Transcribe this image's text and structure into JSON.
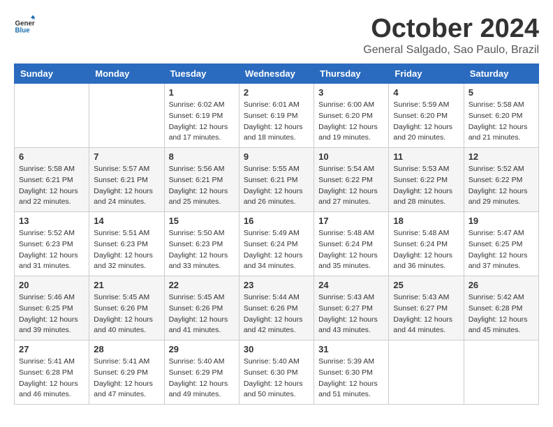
{
  "header": {
    "logo_general": "General",
    "logo_blue": "Blue",
    "month_title": "October 2024",
    "location": "General Salgado, Sao Paulo, Brazil"
  },
  "calendar": {
    "days_of_week": [
      "Sunday",
      "Monday",
      "Tuesday",
      "Wednesday",
      "Thursday",
      "Friday",
      "Saturday"
    ],
    "weeks": [
      [
        {
          "day": "",
          "info": ""
        },
        {
          "day": "",
          "info": ""
        },
        {
          "day": "1",
          "info": "Sunrise: 6:02 AM\nSunset: 6:19 PM\nDaylight: 12 hours\nand 17 minutes."
        },
        {
          "day": "2",
          "info": "Sunrise: 6:01 AM\nSunset: 6:19 PM\nDaylight: 12 hours\nand 18 minutes."
        },
        {
          "day": "3",
          "info": "Sunrise: 6:00 AM\nSunset: 6:20 PM\nDaylight: 12 hours\nand 19 minutes."
        },
        {
          "day": "4",
          "info": "Sunrise: 5:59 AM\nSunset: 6:20 PM\nDaylight: 12 hours\nand 20 minutes."
        },
        {
          "day": "5",
          "info": "Sunrise: 5:58 AM\nSunset: 6:20 PM\nDaylight: 12 hours\nand 21 minutes."
        }
      ],
      [
        {
          "day": "6",
          "info": "Sunrise: 5:58 AM\nSunset: 6:21 PM\nDaylight: 12 hours\nand 22 minutes."
        },
        {
          "day": "7",
          "info": "Sunrise: 5:57 AM\nSunset: 6:21 PM\nDaylight: 12 hours\nand 24 minutes."
        },
        {
          "day": "8",
          "info": "Sunrise: 5:56 AM\nSunset: 6:21 PM\nDaylight: 12 hours\nand 25 minutes."
        },
        {
          "day": "9",
          "info": "Sunrise: 5:55 AM\nSunset: 6:21 PM\nDaylight: 12 hours\nand 26 minutes."
        },
        {
          "day": "10",
          "info": "Sunrise: 5:54 AM\nSunset: 6:22 PM\nDaylight: 12 hours\nand 27 minutes."
        },
        {
          "day": "11",
          "info": "Sunrise: 5:53 AM\nSunset: 6:22 PM\nDaylight: 12 hours\nand 28 minutes."
        },
        {
          "day": "12",
          "info": "Sunrise: 5:52 AM\nSunset: 6:22 PM\nDaylight: 12 hours\nand 29 minutes."
        }
      ],
      [
        {
          "day": "13",
          "info": "Sunrise: 5:52 AM\nSunset: 6:23 PM\nDaylight: 12 hours\nand 31 minutes."
        },
        {
          "day": "14",
          "info": "Sunrise: 5:51 AM\nSunset: 6:23 PM\nDaylight: 12 hours\nand 32 minutes."
        },
        {
          "day": "15",
          "info": "Sunrise: 5:50 AM\nSunset: 6:23 PM\nDaylight: 12 hours\nand 33 minutes."
        },
        {
          "day": "16",
          "info": "Sunrise: 5:49 AM\nSunset: 6:24 PM\nDaylight: 12 hours\nand 34 minutes."
        },
        {
          "day": "17",
          "info": "Sunrise: 5:48 AM\nSunset: 6:24 PM\nDaylight: 12 hours\nand 35 minutes."
        },
        {
          "day": "18",
          "info": "Sunrise: 5:48 AM\nSunset: 6:24 PM\nDaylight: 12 hours\nand 36 minutes."
        },
        {
          "day": "19",
          "info": "Sunrise: 5:47 AM\nSunset: 6:25 PM\nDaylight: 12 hours\nand 37 minutes."
        }
      ],
      [
        {
          "day": "20",
          "info": "Sunrise: 5:46 AM\nSunset: 6:25 PM\nDaylight: 12 hours\nand 39 minutes."
        },
        {
          "day": "21",
          "info": "Sunrise: 5:45 AM\nSunset: 6:26 PM\nDaylight: 12 hours\nand 40 minutes."
        },
        {
          "day": "22",
          "info": "Sunrise: 5:45 AM\nSunset: 6:26 PM\nDaylight: 12 hours\nand 41 minutes."
        },
        {
          "day": "23",
          "info": "Sunrise: 5:44 AM\nSunset: 6:26 PM\nDaylight: 12 hours\nand 42 minutes."
        },
        {
          "day": "24",
          "info": "Sunrise: 5:43 AM\nSunset: 6:27 PM\nDaylight: 12 hours\nand 43 minutes."
        },
        {
          "day": "25",
          "info": "Sunrise: 5:43 AM\nSunset: 6:27 PM\nDaylight: 12 hours\nand 44 minutes."
        },
        {
          "day": "26",
          "info": "Sunrise: 5:42 AM\nSunset: 6:28 PM\nDaylight: 12 hours\nand 45 minutes."
        }
      ],
      [
        {
          "day": "27",
          "info": "Sunrise: 5:41 AM\nSunset: 6:28 PM\nDaylight: 12 hours\nand 46 minutes."
        },
        {
          "day": "28",
          "info": "Sunrise: 5:41 AM\nSunset: 6:29 PM\nDaylight: 12 hours\nand 47 minutes."
        },
        {
          "day": "29",
          "info": "Sunrise: 5:40 AM\nSunset: 6:29 PM\nDaylight: 12 hours\nand 49 minutes."
        },
        {
          "day": "30",
          "info": "Sunrise: 5:40 AM\nSunset: 6:30 PM\nDaylight: 12 hours\nand 50 minutes."
        },
        {
          "day": "31",
          "info": "Sunrise: 5:39 AM\nSunset: 6:30 PM\nDaylight: 12 hours\nand 51 minutes."
        },
        {
          "day": "",
          "info": ""
        },
        {
          "day": "",
          "info": ""
        }
      ]
    ]
  }
}
